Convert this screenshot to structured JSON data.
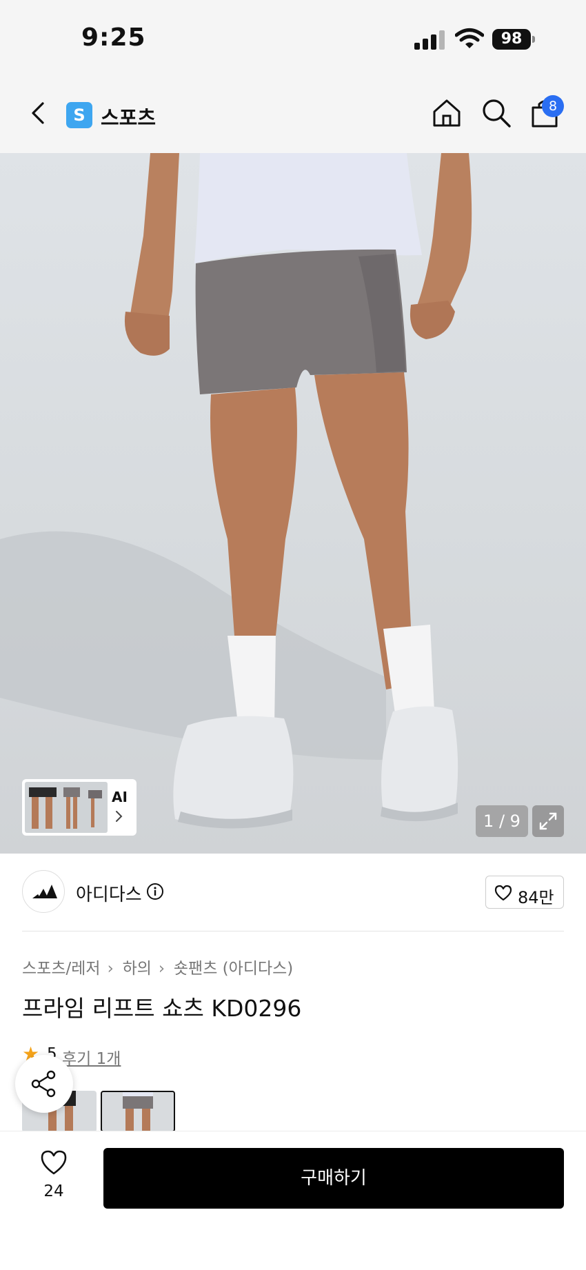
{
  "status_bar": {
    "time": "9:25",
    "battery": "98"
  },
  "header": {
    "store_logo_letter": "S",
    "store_name": "스포츠",
    "cart_badge": "8"
  },
  "gallery": {
    "ai_label": "AI",
    "pager": "1 / 9"
  },
  "brand": {
    "name": "아디다스",
    "like_count": "84만"
  },
  "breadcrumb": [
    "스포츠/레저",
    "하의",
    "숏팬츠 (아디다스)"
  ],
  "product": {
    "title": "프라임 리프트 쇼츠 KD0296",
    "rating": "5",
    "review_link": "후기 1개"
  },
  "bottom_bar": {
    "wish_count": "24",
    "buy_label": "구매하기"
  },
  "colors": {
    "accent_blue": "#2a6ef2",
    "store_logo": "#3ea6f0",
    "star": "#f5a31a",
    "buy_button": "#000000"
  }
}
